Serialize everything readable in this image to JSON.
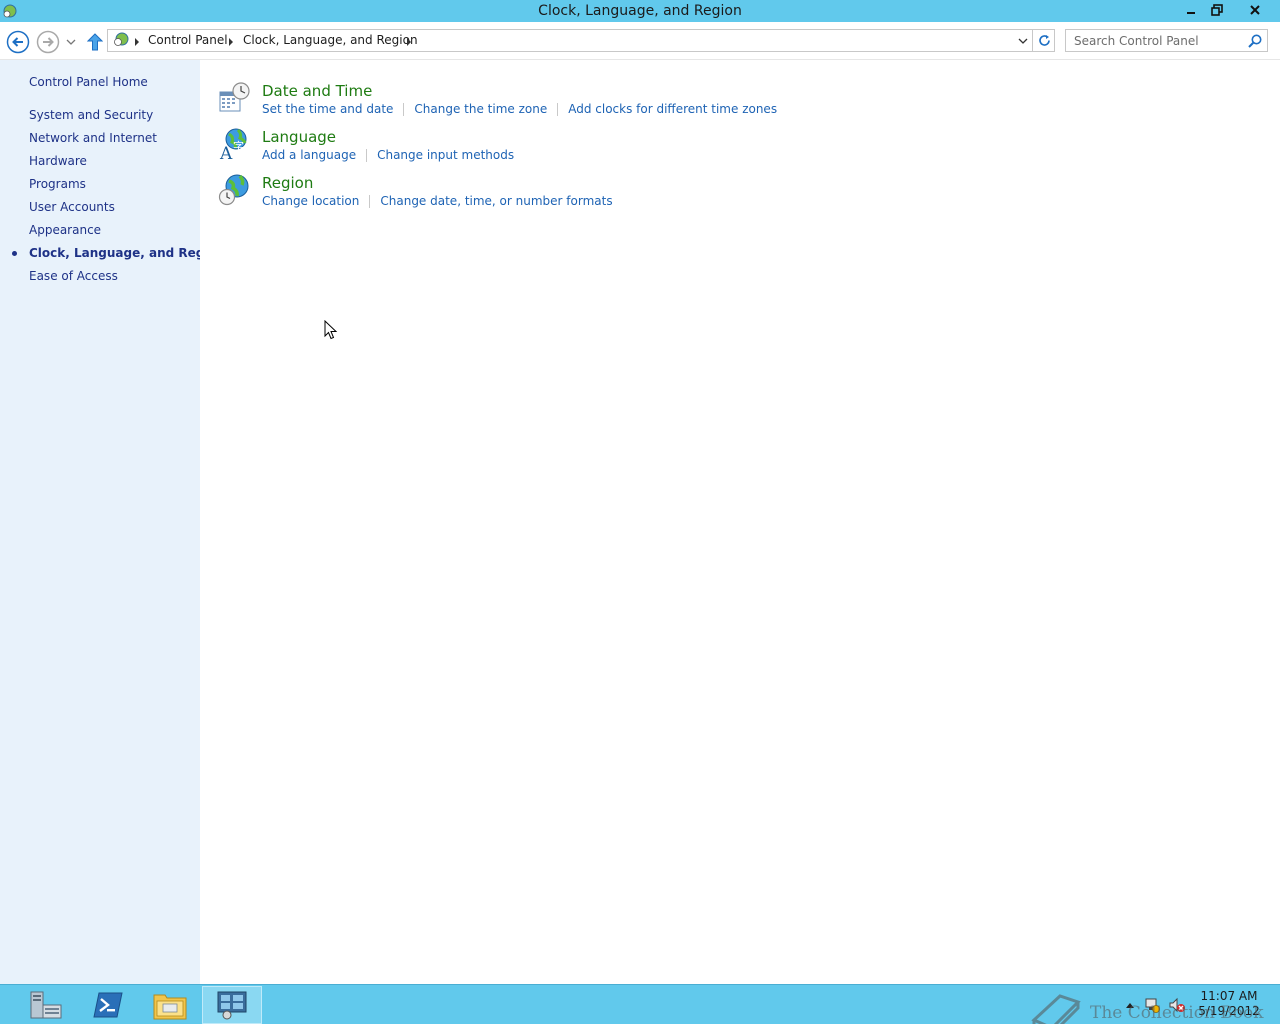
{
  "window": {
    "title": "Clock, Language, and Region",
    "controls": {
      "minimize": "minimize",
      "restore": "restore",
      "close": "close"
    }
  },
  "nav": {
    "breadcrumbs": [
      {
        "label": "Control Panel"
      },
      {
        "label": "Clock, Language, and Region"
      }
    ],
    "search": {
      "placeholder": "Search Control Panel",
      "value": ""
    }
  },
  "sidebar": {
    "home": "Control Panel Home",
    "items": [
      {
        "label": "System and Security"
      },
      {
        "label": "Network and Internet"
      },
      {
        "label": "Hardware"
      },
      {
        "label": "Programs"
      },
      {
        "label": "User Accounts"
      },
      {
        "label": "Appearance"
      },
      {
        "label": "Clock, Language, and Region",
        "active": true
      },
      {
        "label": "Ease of Access"
      }
    ]
  },
  "categories": [
    {
      "title": "Date and Time",
      "icon": "calendar-clock-icon",
      "links": [
        "Set the time and date",
        "Change the time zone",
        "Add clocks for different time zones"
      ]
    },
    {
      "title": "Language",
      "icon": "language-globe-icon",
      "links": [
        "Add a language",
        "Change input methods"
      ]
    },
    {
      "title": "Region",
      "icon": "region-globe-clock-icon",
      "links": [
        "Change location",
        "Change date, time, or number formats"
      ]
    }
  ],
  "taskbar": {
    "apps": [
      "server-manager-icon",
      "powershell-icon",
      "file-explorer-icon",
      "control-panel-icon"
    ],
    "active_app": "control-panel-icon",
    "clock": {
      "time": "11:07 AM",
      "date": "5/19/2012"
    },
    "tray_icons": [
      "show-hidden-icons-arrow",
      "network-icon",
      "speaker-muted-icon"
    ]
  },
  "watermark": "The Collection Book",
  "colors": {
    "titlebar": "#61c9ec",
    "sidebar": "#e8f2fb",
    "category_title": "#1e7b12",
    "link": "#1e63b4",
    "sidebar_link": "#1e3287"
  }
}
